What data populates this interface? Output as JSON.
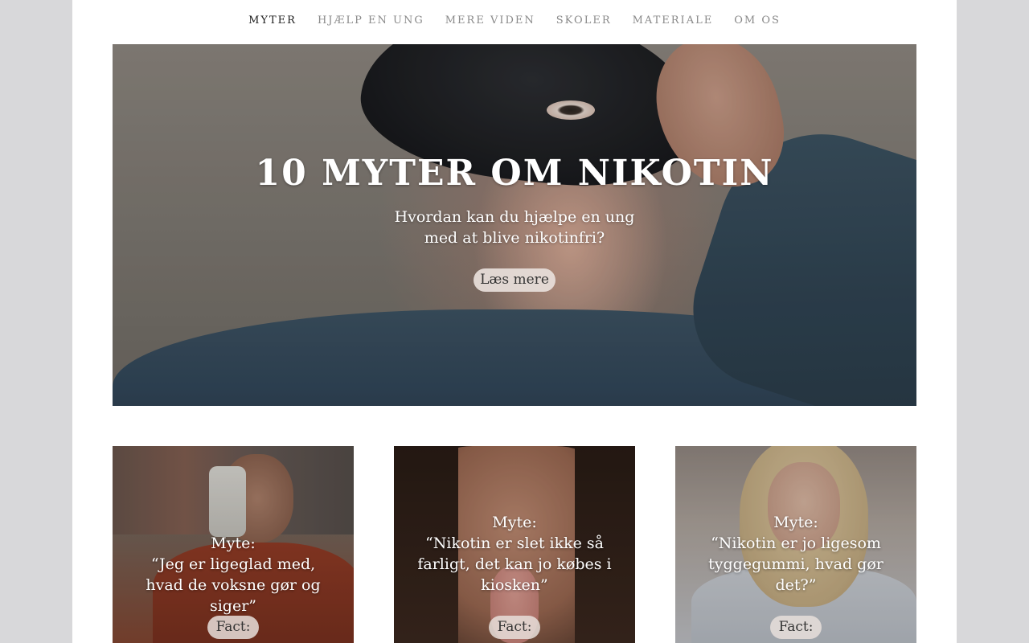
{
  "nav": {
    "items": [
      {
        "label": "MYTER",
        "active": true
      },
      {
        "label": "HJÆLP EN UNG",
        "active": false
      },
      {
        "label": "MERE VIDEN",
        "active": false
      },
      {
        "label": "SKOLER",
        "active": false
      },
      {
        "label": "MATERIALE",
        "active": false
      },
      {
        "label": "OM OS",
        "active": false
      }
    ]
  },
  "hero": {
    "title": "10 MYTER OM NIKOTIN",
    "subtitle": "Hvordan kan du hjælpe en ung med at blive nikotinfri?",
    "button_label": "Læs mere"
  },
  "cards": [
    {
      "label": "Myte:",
      "text": "“Jeg er ligeglad med, hvad de voksne gør og siger”",
      "button_label": "Fact:"
    },
    {
      "label": "Myte:",
      "text": "“Nikotin er slet ikke så farligt, det kan jo købes i kiosken”",
      "button_label": "Fact:"
    },
    {
      "label": "Myte:",
      "text": "“Nikotin er jo ligesom tyggegummi, hvad gør det?”",
      "button_label": "Fact:"
    }
  ],
  "colors": {
    "background": "#d8d8da",
    "page": "#ffffff",
    "nav_active": "#1d1d1d",
    "nav_inactive": "#8a8a8a",
    "pill_button": "#e8dfdb"
  }
}
